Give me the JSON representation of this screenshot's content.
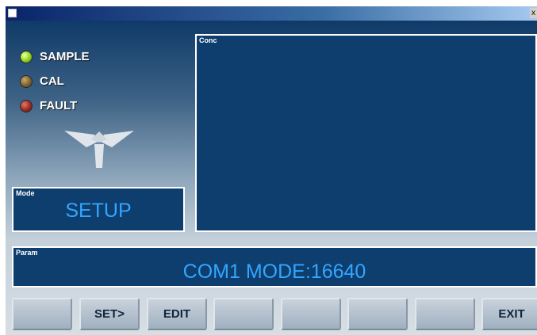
{
  "window": {
    "close_glyph": "x"
  },
  "indicators": [
    {
      "label": "SAMPLE",
      "state": "on",
      "color": "#9ce02a"
    },
    {
      "label": "CAL",
      "state": "off",
      "color": "#7d6333"
    },
    {
      "label": "FAULT",
      "state": "off",
      "color": "#9a2b22"
    }
  ],
  "logo": {
    "icon": "teledyne-logo-icon"
  },
  "mode": {
    "caption": "Mode",
    "value": "SETUP"
  },
  "conc": {
    "caption": "Conc"
  },
  "param": {
    "caption": "Param",
    "value": "COM1 MODE:16640"
  },
  "keys": [
    "",
    "SET>",
    "EDIT",
    "",
    "",
    "",
    "",
    "EXIT"
  ],
  "colors": {
    "panel_bg": "#0e3e6e",
    "value_text": "#33a6ff"
  }
}
